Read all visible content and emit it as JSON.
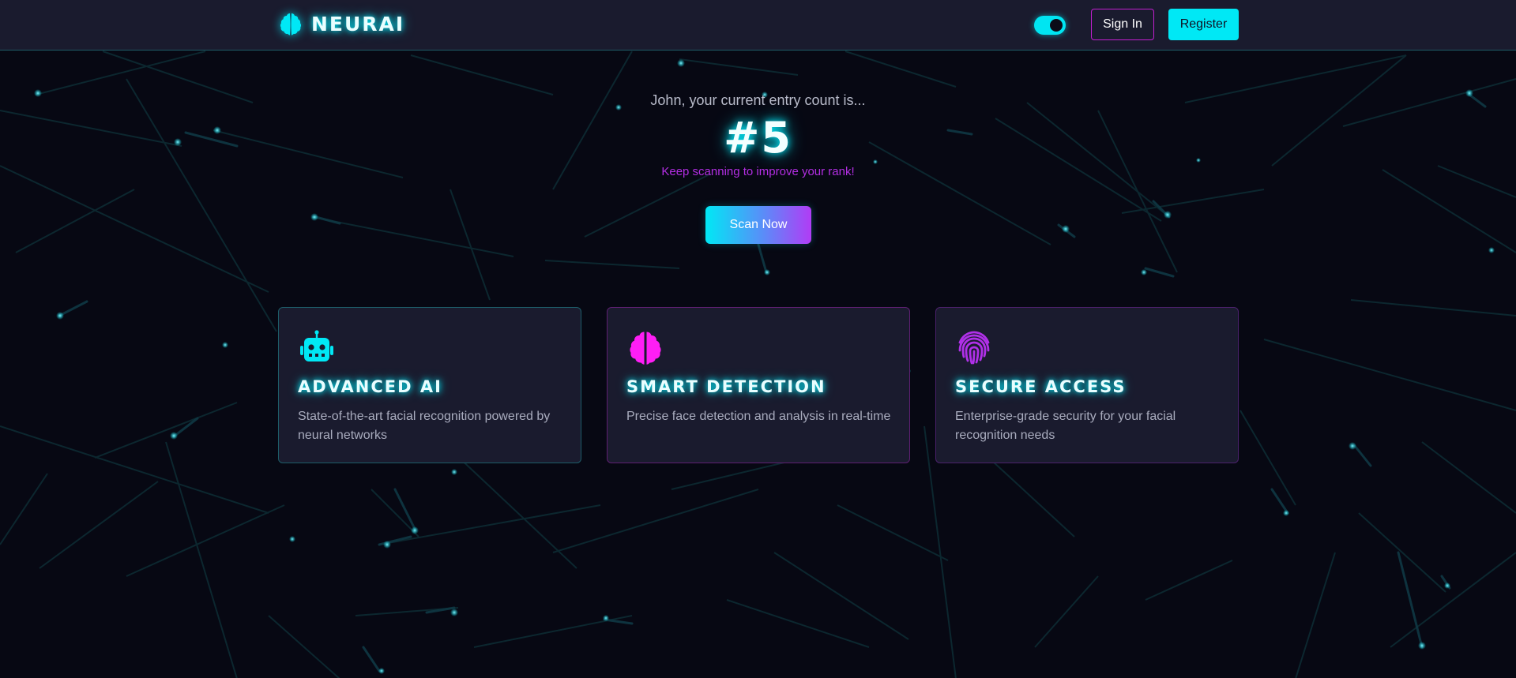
{
  "app": {
    "brand_name": "NEURAI",
    "brand_icon": "brain-icon",
    "accent_cyan": "#00e8f5",
    "accent_magenta": "#c21fd0",
    "accent_purple": "#b32ee3"
  },
  "header": {
    "theme_toggle": {
      "state": "on"
    },
    "sign_in_label": "Sign In",
    "register_label": "Register"
  },
  "hero": {
    "entry_text": "John, your current entry count is...",
    "rank": "#5",
    "encourage_text": "Keep scanning to improve your rank!",
    "scan_button_label": "Scan Now"
  },
  "features": [
    {
      "icon": "robot-icon",
      "title": "ADVANCED AI",
      "description": "State-of-the-art facial recognition powered by neural networks"
    },
    {
      "icon": "brain-icon",
      "title": "SMART DETECTION",
      "description": "Precise face detection and analysis in real-time"
    },
    {
      "icon": "fingerprint-icon",
      "title": "SECURE ACCESS",
      "description": "Enterprise-grade security for your facial recognition needs"
    }
  ]
}
